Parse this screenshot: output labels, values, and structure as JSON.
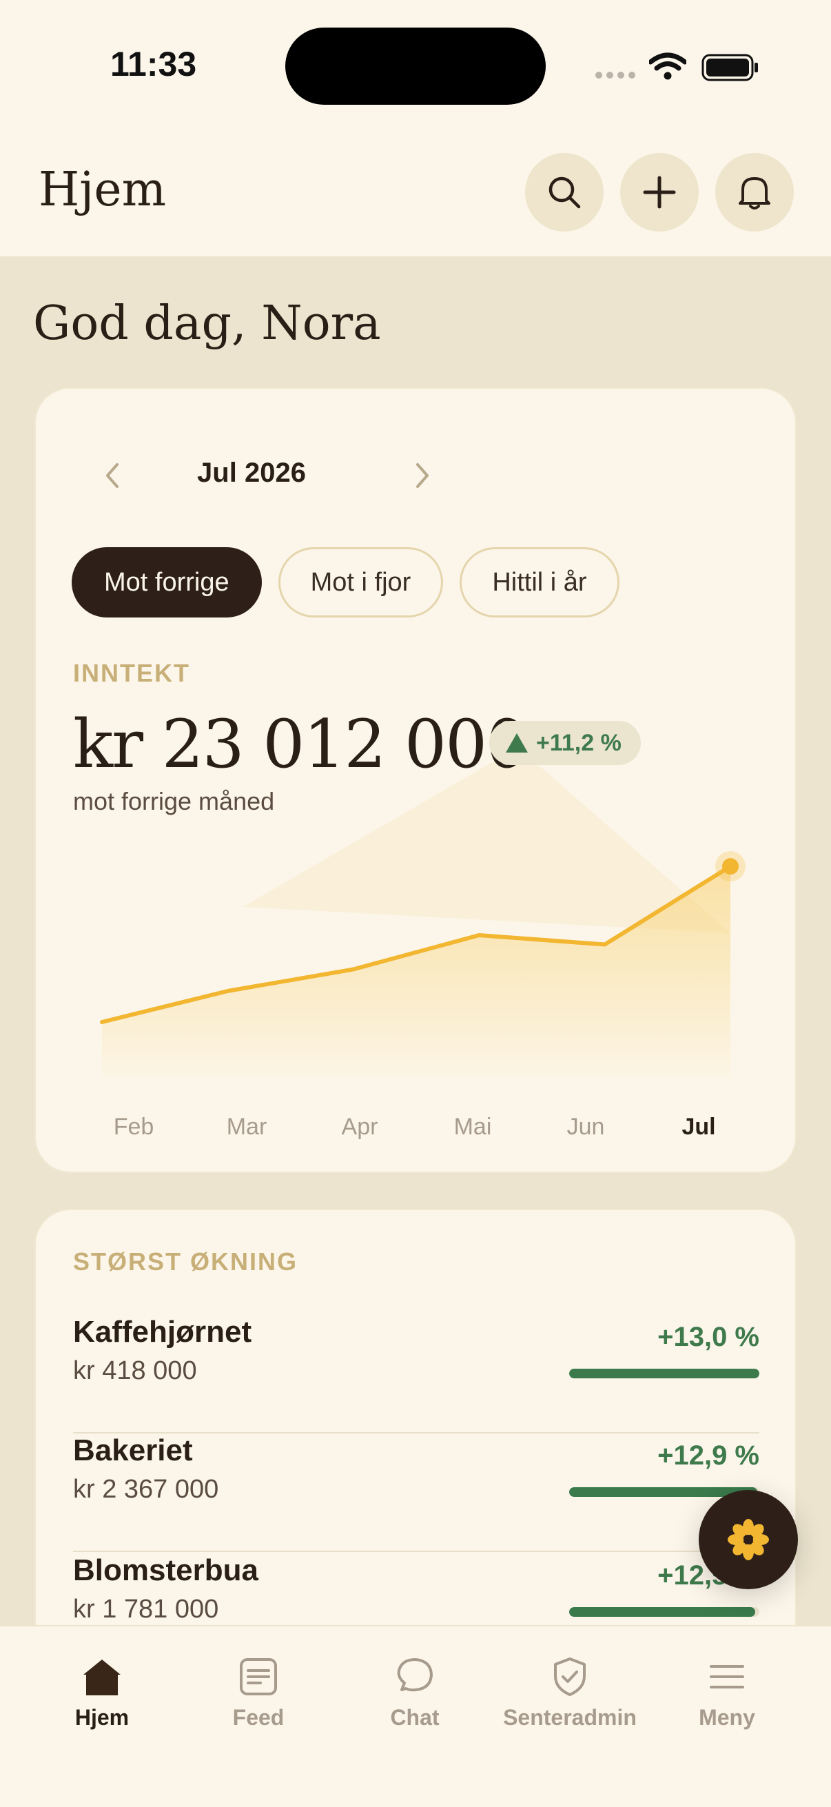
{
  "status_bar": {
    "time": "11:33"
  },
  "header": {
    "title": "Hjem"
  },
  "greeting": "God dag, Nora",
  "period": {
    "label": "Jul 2026"
  },
  "comparison_tabs": [
    {
      "label": "Mot forrige",
      "active": true
    },
    {
      "label": "Mot i fjor",
      "active": false
    },
    {
      "label": "Hittil i år",
      "active": false
    }
  ],
  "revenue": {
    "label": "INNTEKT",
    "amount": "kr 23 012 000",
    "change": "+11,2 %",
    "subtitle": "mot forrige måned"
  },
  "chart_data": {
    "type": "area",
    "categories": [
      "Feb",
      "Mar",
      "Apr",
      "Mai",
      "Jun",
      "Jul"
    ],
    "values": [
      20.5,
      21.0,
      21.35,
      21.9,
      21.75,
      23.01
    ],
    "ylim": [
      19.6,
      23.6
    ],
    "selected": "Jul",
    "color": "#F2B631",
    "grid": false
  },
  "top_growth": {
    "label": "STØRST ØKNING",
    "items": [
      {
        "name": "Kaffehjørnet",
        "amount": "kr 418 000",
        "change": "+13,0 %",
        "bar": 1.0
      },
      {
        "name": "Bakeriet",
        "amount": "kr 2 367 000",
        "change": "+12,9 %",
        "bar": 0.99
      },
      {
        "name": "Blomsterbua",
        "amount": "kr 1 781 000",
        "change": "+12,5 %",
        "bar": 0.98
      }
    ]
  },
  "tabbar": [
    {
      "label": "Hjem",
      "icon": "home-icon",
      "active": true
    },
    {
      "label": "Feed",
      "icon": "feed-icon",
      "active": false
    },
    {
      "label": "Chat",
      "icon": "chat-icon",
      "active": false
    },
    {
      "label": "Senteradmin",
      "icon": "shield-check-icon",
      "active": false
    },
    {
      "label": "Meny",
      "icon": "menu-icon",
      "active": false
    }
  ],
  "colors": {
    "accent": "#F2B631",
    "positive": "#3E7A4C",
    "dark": "#2E2018",
    "background": "#ECE4CE",
    "surface": "#FCF6EA"
  }
}
